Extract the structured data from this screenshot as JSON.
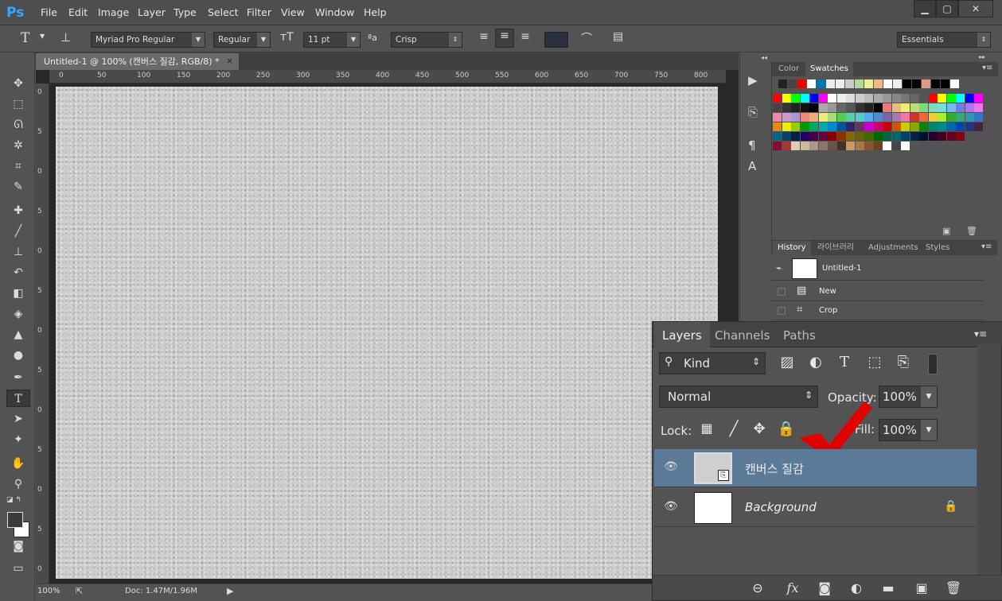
{
  "app": {
    "logo": "Ps"
  },
  "menu": [
    "File",
    "Edit",
    "Image",
    "Layer",
    "Type",
    "Select",
    "Filter",
    "View",
    "Window",
    "Help"
  ],
  "window_controls": {
    "minimize": "▁",
    "maximize": "▢",
    "close": "✕"
  },
  "options_bar": {
    "tool_glyph": "T",
    "font_family": "Myriad Pro Regular",
    "font_style": "Regular",
    "font_size": "11 pt",
    "aa_label": "ªa",
    "antialias": "Crisp",
    "workspace": "Essentials",
    "text_color": "#2a3040"
  },
  "document": {
    "tab_title": "Untitled-1 @ 100% (캔버스 질감, RGB/8) *",
    "close": "×",
    "ruler_h": [
      "0",
      "50",
      "100",
      "150",
      "200",
      "250",
      "300",
      "350",
      "400",
      "450",
      "500",
      "550",
      "600",
      "650",
      "700",
      "750",
      "800"
    ],
    "ruler_v": [
      "0",
      "5",
      "0",
      "5",
      "0",
      "5",
      "0",
      "5",
      "0",
      "5",
      "0",
      "5",
      "0"
    ],
    "zoom": "100%",
    "doc_size": "Doc: 1.47M/1.96M"
  },
  "swatches_panel": {
    "tabs": [
      "Color",
      "Swatches"
    ],
    "active_tab": "Swatches"
  },
  "history_panel": {
    "tabs": [
      "History",
      "라이브러리",
      "Adjustments",
      "Styles"
    ],
    "snapshot": "Untitled-1",
    "steps": [
      "New",
      "Crop"
    ]
  },
  "layers_panel": {
    "tabs": [
      "Layers",
      "Channels",
      "Paths"
    ],
    "filter_kind": "Kind",
    "blend_mode": "Normal",
    "opacity_label": "Opacity:",
    "opacity_value": "100%",
    "lock_label": "Lock:",
    "fill_label": "Fill:",
    "fill_value": "100%",
    "layers": [
      {
        "name": "캔버스 질감",
        "selected": true
      },
      {
        "name": "Background",
        "selected": false,
        "locked": true
      }
    ]
  },
  "colors": {
    "selected_layer": "#5a7a98",
    "annotation_check": "#e00000"
  }
}
